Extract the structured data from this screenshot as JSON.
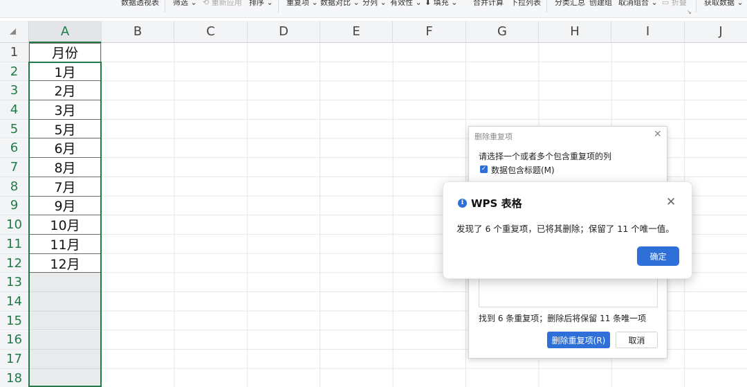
{
  "ribbon": {
    "pivot": "数据透视表",
    "filter": "筛选",
    "reapply": "重新应用",
    "sort": "排序",
    "duplicates": "重复项",
    "compare": "数据对比",
    "split": "分列",
    "validity": "有效性",
    "fill": "填充",
    "consolidate": "合并计算",
    "dropdown": "下拉列表",
    "subtotal": "分类汇总",
    "group": "创建组",
    "ungroup": "取消组合",
    "fold": "折叠",
    "get_data": "获取数据"
  },
  "columns": [
    "A",
    "B",
    "C",
    "D",
    "E",
    "F",
    "G",
    "H",
    "I",
    "J"
  ],
  "rows": [
    "1",
    "2",
    "3",
    "4",
    "5",
    "6",
    "7",
    "8",
    "9",
    "10",
    "11",
    "12",
    "13",
    "14",
    "15",
    "16",
    "17",
    "18"
  ],
  "column_a": [
    "月份",
    "1月",
    "2月",
    "3月",
    "5月",
    "6月",
    "8月",
    "7月",
    "9月",
    "10月",
    "11月",
    "12月"
  ],
  "back_dialog": {
    "title": "删除重复项",
    "prompt": "请选择一个或者多个包含重复项的列",
    "checkbox_label": "数据包含标题(M)",
    "status": "找到 6 条重复项；删除后将保留 11 条唯一项",
    "delete_button": "删除重复项(R)",
    "cancel_button": "取消"
  },
  "info_dialog": {
    "title": "WPS 表格",
    "message": "发现了 6 个重复项，已将其删除；保留了 11 个唯一值。",
    "ok_button": "确定"
  },
  "colors": {
    "accent_green": "#1f7a46",
    "button_blue": "#2e6fd8"
  }
}
